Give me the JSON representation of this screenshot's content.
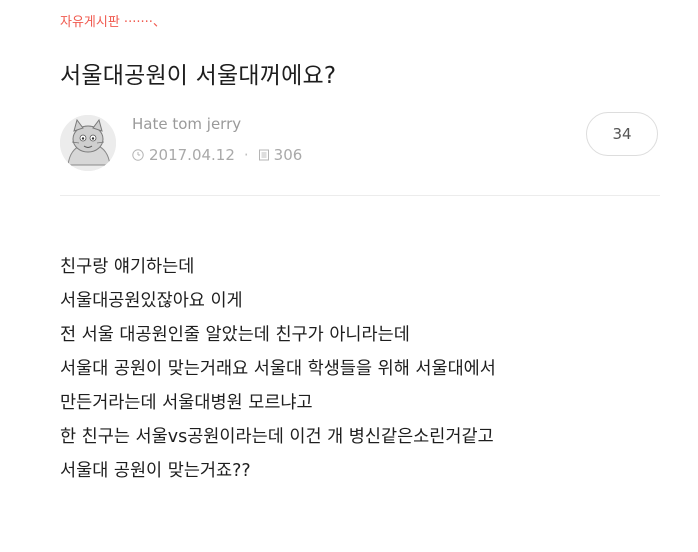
{
  "board": {
    "label": "자유게시판 ·······、"
  },
  "post": {
    "title": "서울대공원이 서울대꺼에요?",
    "author": "Hate tom jerry",
    "date": "2017.04.12",
    "separator": "·",
    "views": "306",
    "comment_count": "34",
    "body_lines": [
      "친구랑 얘기하는데",
      "서울대공원있잖아요 이게",
      "전 서울 대공원인줄 알았는데 친구가 아니라는데",
      "서울대 공원이 맞는거래요 서울대 학생들을 위해 서울대에서",
      "만든거라는데 서울대병원 모르냐고",
      "한 친구는 서울vs공원이라는데 이건 개 병신같은소린거같고",
      "서울대 공원이 맞는거죠??"
    ]
  },
  "icons": {
    "clock": "clock-icon",
    "views": "document-icon",
    "avatar": "avatar-cartoon-cat"
  },
  "colors": {
    "board_label": "#f05a4f",
    "meta_text": "#a9a9a9",
    "title_text": "#1e1e1e"
  }
}
